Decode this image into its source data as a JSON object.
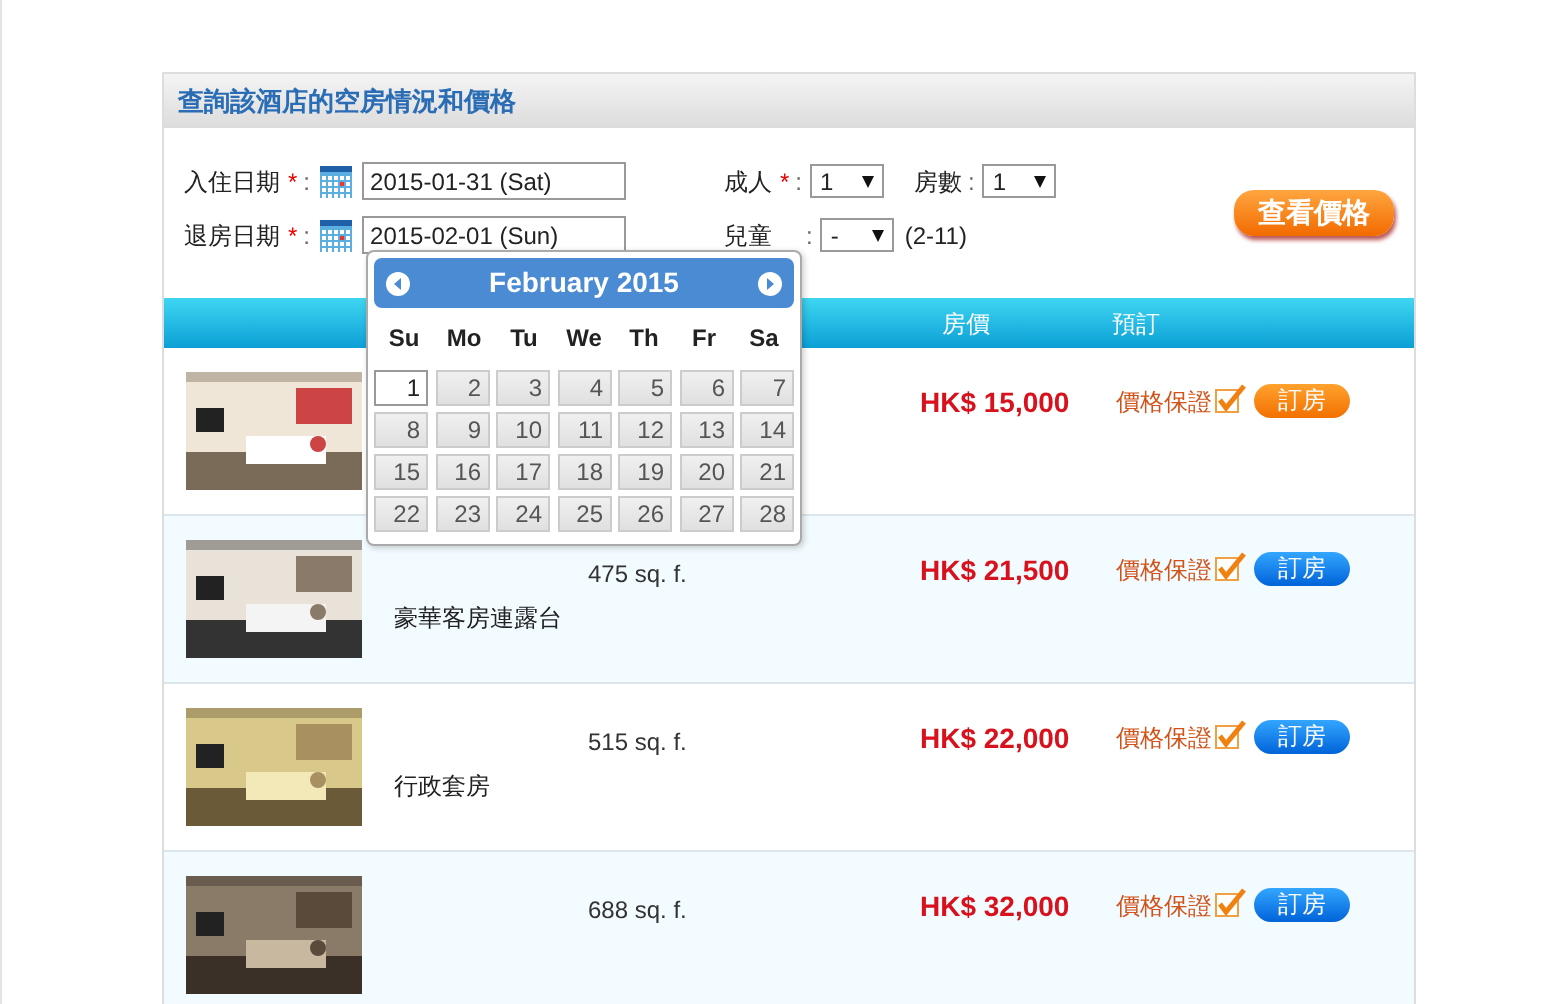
{
  "panel": {
    "title": "查詢該酒店的空房情況和價格"
  },
  "dates": [
    {
      "label": "入住日期",
      "mark": "*",
      "colon": ":",
      "value": "2015-01-31 (Sat)"
    },
    {
      "label": "退房日期",
      "mark": "*",
      "colon": ":",
      "value": "2015-02-01 (Sun)"
    }
  ],
  "guests": [
    {
      "label": "成人",
      "mark": "*",
      "colon": ":",
      "value": "1"
    },
    {
      "label": "房數",
      "colon": ":",
      "value": "1"
    },
    {
      "label": "兒童",
      "colon": ":",
      "value": "-",
      "hint": "(2-11)"
    }
  ],
  "search_button": "查看價格",
  "table": {
    "columns": [
      "房價",
      "預訂"
    ],
    "rows": [
      {
        "price": "HK$ 15,000",
        "guarantee": "價格保證",
        "book": "訂房",
        "selected": true
      },
      {
        "size": "475 sq. f.",
        "name": "豪華客房連露台",
        "price": "HK$ 21,500",
        "guarantee": "價格保證",
        "book": "訂房",
        "selected": false
      },
      {
        "size": "515 sq. f.",
        "name": "行政套房",
        "price": "HK$ 22,000",
        "guarantee": "價格保證",
        "book": "訂房",
        "selected": false
      },
      {
        "size": "688 sq. f.",
        "price": "HK$ 32,000",
        "guarantee": "價格保證",
        "book": "訂房",
        "selected": false
      }
    ]
  },
  "calendar": {
    "title": "February 2015",
    "weekdays": [
      "Su",
      "Mo",
      "Tu",
      "We",
      "Th",
      "Fr",
      "Sa"
    ],
    "days": [
      {
        "day": "1",
        "selected": true
      },
      {
        "day": "2",
        "selected": false
      },
      {
        "day": "3",
        "selected": false
      },
      {
        "day": "4",
        "selected": false
      },
      {
        "day": "5",
        "selected": false
      },
      {
        "day": "6",
        "selected": false
      },
      {
        "day": "7",
        "selected": false
      },
      {
        "day": "8",
        "selected": false
      },
      {
        "day": "9",
        "selected": false
      },
      {
        "day": "10",
        "selected": false
      },
      {
        "day": "11",
        "selected": false
      },
      {
        "day": "12",
        "selected": false
      },
      {
        "day": "13",
        "selected": false
      },
      {
        "day": "14",
        "selected": false
      },
      {
        "day": "15",
        "selected": false
      },
      {
        "day": "16",
        "selected": false
      },
      {
        "day": "17",
        "selected": false
      },
      {
        "day": "18",
        "selected": false
      },
      {
        "day": "19",
        "selected": false
      },
      {
        "day": "20",
        "selected": false
      },
      {
        "day": "21",
        "selected": false
      },
      {
        "day": "22",
        "selected": false
      },
      {
        "day": "23",
        "selected": false
      },
      {
        "day": "24",
        "selected": false
      },
      {
        "day": "25",
        "selected": false
      },
      {
        "day": "26",
        "selected": false
      },
      {
        "day": "27",
        "selected": false
      },
      {
        "day": "28",
        "selected": false
      }
    ]
  }
}
